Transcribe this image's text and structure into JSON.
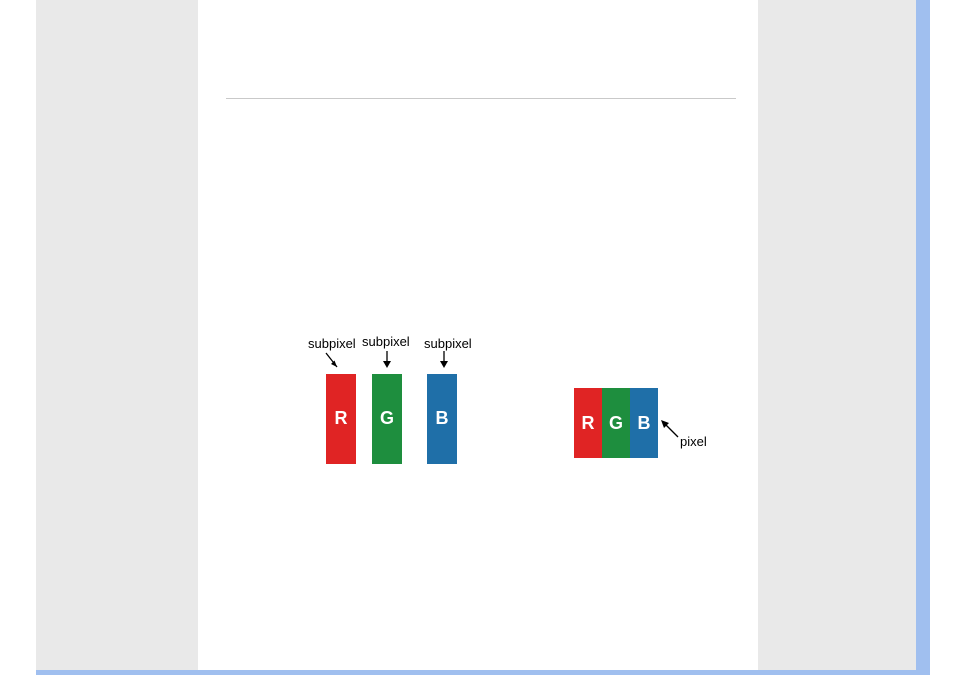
{
  "labels": {
    "subpixel1": "subpixel",
    "subpixel2": "subpixel",
    "subpixel3": "subpixel",
    "pixel": "pixel"
  },
  "subpixels": {
    "r": {
      "letter": "R",
      "color": "#e02424"
    },
    "g": {
      "letter": "G",
      "color": "#1e8e3e"
    },
    "b": {
      "letter": "B",
      "color": "#1f6fa8"
    }
  },
  "pixel": {
    "r": {
      "letter": "R",
      "color": "#e02424"
    },
    "g": {
      "letter": "G",
      "color": "#1e8e3e"
    },
    "b": {
      "letter": "B",
      "color": "#1f6fa8"
    }
  }
}
